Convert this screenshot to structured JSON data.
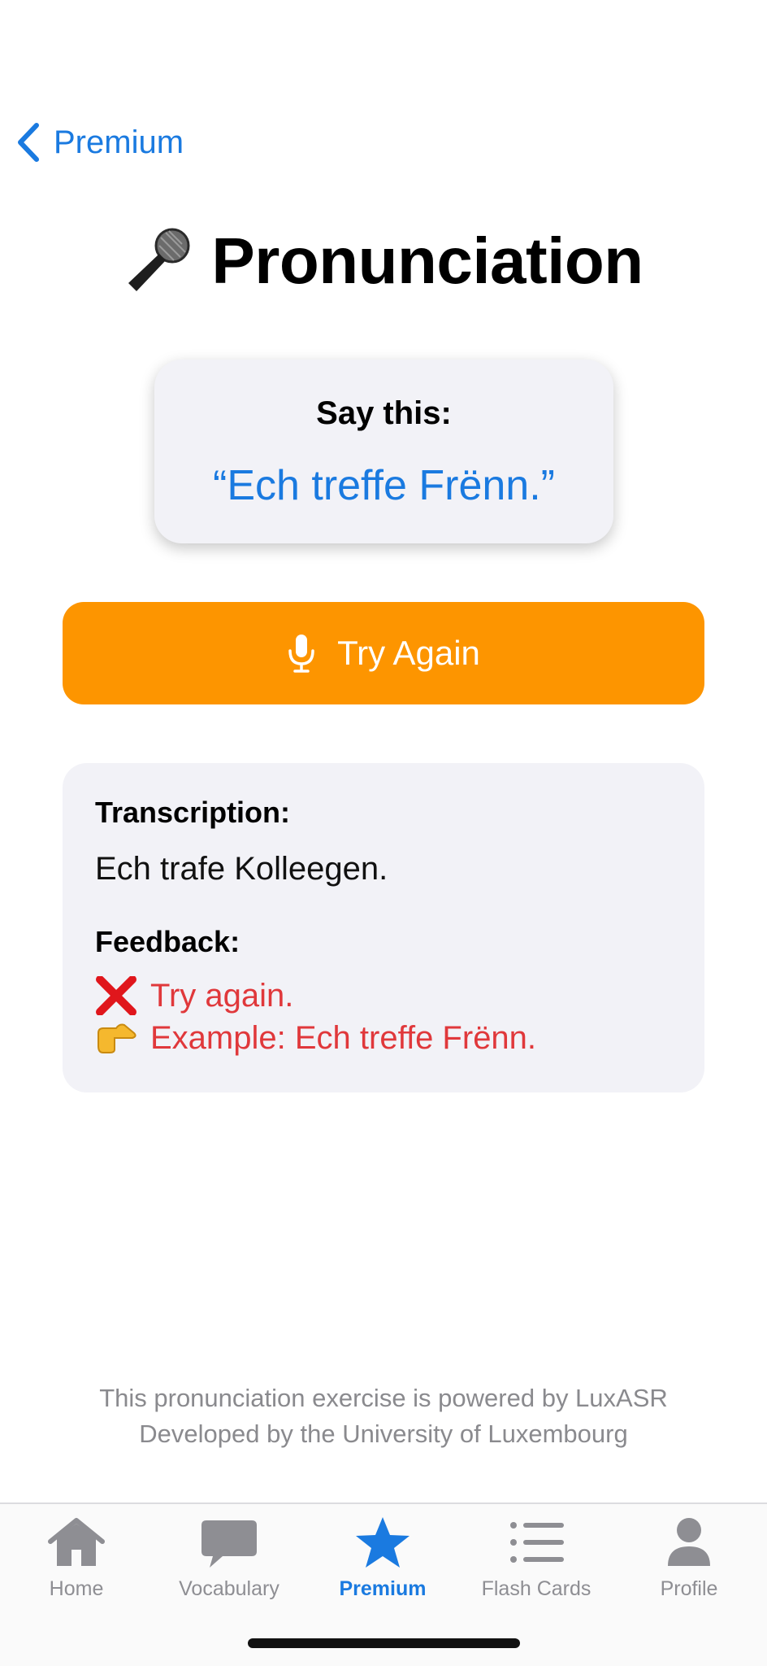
{
  "nav": {
    "back_label": "Premium"
  },
  "page": {
    "title": "Pronunciation"
  },
  "prompt": {
    "label": "Say this:",
    "phrase": "“Ech treffe Frënn.”"
  },
  "action": {
    "button_label": "Try Again"
  },
  "result": {
    "transcription_label": "Transcription:",
    "transcription_text": "Ech trafe Kolleegen.",
    "feedback_label": "Feedback:",
    "feedback_status": "Try again.",
    "feedback_example": "Example: Ech treffe Frënn."
  },
  "credits": {
    "line1": "This pronunciation exercise is powered by LuxASR",
    "line2": "Developed by the University of Luxembourg"
  },
  "tabbar": {
    "items": [
      {
        "label": "Home",
        "icon": "house-icon"
      },
      {
        "label": "Vocabulary",
        "icon": "speech-bubble-icon"
      },
      {
        "label": "Premium",
        "icon": "star-icon",
        "active": true
      },
      {
        "label": "Flash Cards",
        "icon": "list-icon"
      },
      {
        "label": "Profile",
        "icon": "person-icon"
      }
    ]
  },
  "colors": {
    "accent": "#1a7ae0",
    "button": "#fd9500",
    "error": "#e0383b",
    "card": "#f2f2f7"
  }
}
